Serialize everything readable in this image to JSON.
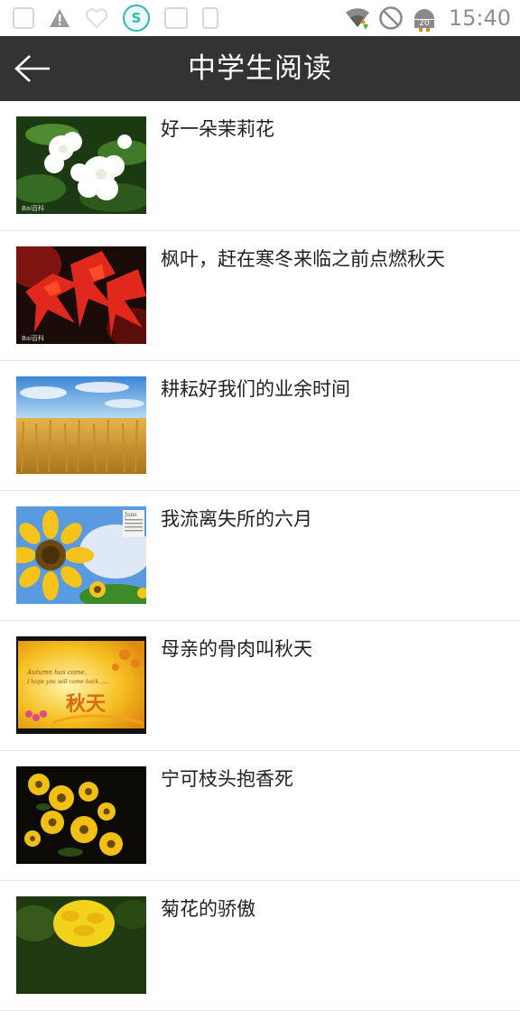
{
  "status_bar": {
    "time": "15:40",
    "badge_count": "20",
    "icons": [
      "notification-icon",
      "warning-icon",
      "heart-icon",
      "shield-app-icon",
      "wifi-icon",
      "do-not-disturb-icon",
      "android-icon"
    ]
  },
  "header": {
    "title": "中学生阅读",
    "back_icon": "arrow-left-icon",
    "background": "#333333"
  },
  "articles": [
    {
      "title": "好一朵茉莉花",
      "image": "jasmine-flowers"
    },
    {
      "title": "枫叶，赶在寒冬来临之前点燃秋天",
      "image": "red-maple-leaves"
    },
    {
      "title": "耕耘好我们的业余时间",
      "image": "wheat-field"
    },
    {
      "title": "我流离失所的六月",
      "image": "sunflower-calendar"
    },
    {
      "title": "母亲的骨肉叫秋天",
      "image": "autumn-card"
    },
    {
      "title": "宁可枝头抱香死",
      "image": "yellow-flowers"
    },
    {
      "title": "菊花的骄傲",
      "image": "chrysanthemum"
    }
  ],
  "thumb_text": {
    "watermark": "Bai百科",
    "calendar_month": "June",
    "autumn_line1": "Autumn has come,",
    "autumn_line2": "I hope you will come back......",
    "autumn_title": "秋天"
  }
}
